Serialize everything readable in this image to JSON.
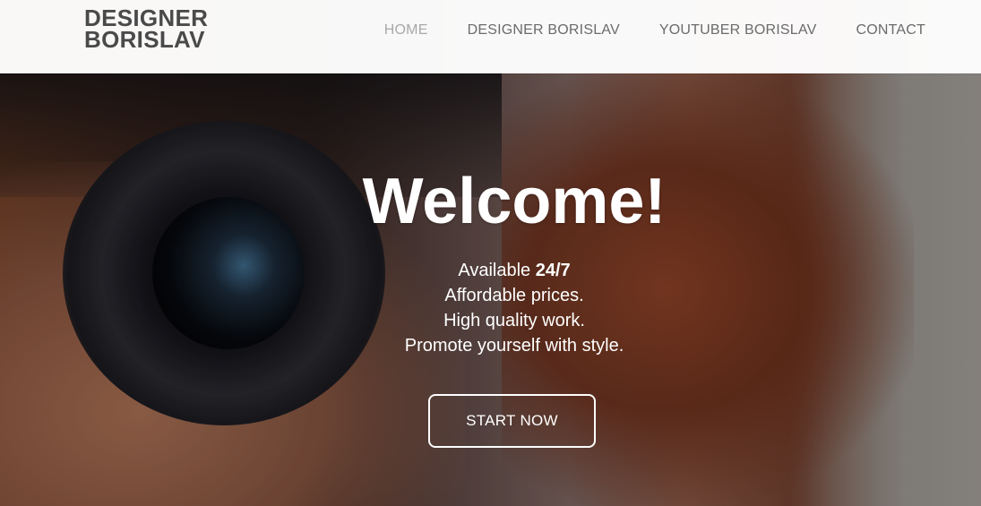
{
  "header": {
    "logo_line1": "DESIGNER",
    "logo_line2": "BORISLAV",
    "nav": [
      {
        "label": "HOME",
        "active": true
      },
      {
        "label": "DESIGNER BORISLAV",
        "active": false
      },
      {
        "label": "YOUTUBER BORISLAV",
        "active": false
      },
      {
        "label": "CONTACT",
        "active": false
      }
    ]
  },
  "hero": {
    "title": "Welcome!",
    "lines": [
      {
        "prefix": "Available ",
        "bold": "24/7"
      },
      {
        "text": "Affordable prices."
      },
      {
        "text": "High quality work."
      },
      {
        "text": "Promote yourself with style."
      }
    ],
    "cta_label": "START NOW"
  },
  "colors": {
    "header_bg": "#ffffff",
    "logo": "#4a4a4a",
    "nav_text": "#6b6b6b",
    "nav_active": "#a8a8a8",
    "hero_text": "#ffffff"
  }
}
